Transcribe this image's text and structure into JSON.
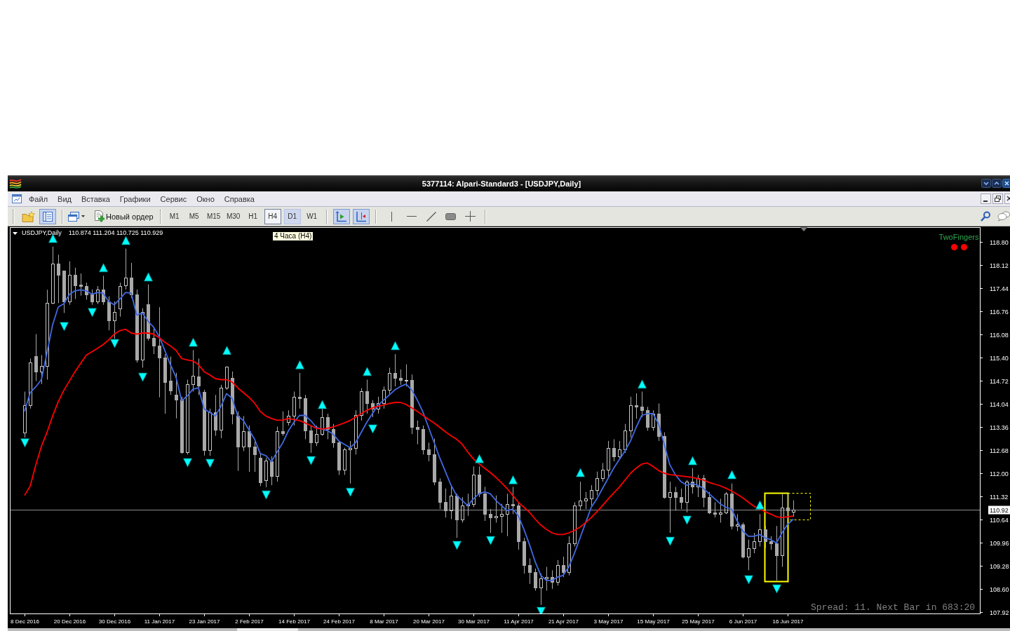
{
  "window": {
    "title": "5377114: Alpari-Standard3 - [USDJPY,Daily]"
  },
  "menu": [
    "Файл",
    "Вид",
    "Вставка",
    "Графики",
    "Сервис",
    "Окно",
    "Справка"
  ],
  "toolbar": {
    "standard": [
      {
        "pressed": false
      },
      {
        "pressed": true
      }
    ],
    "new_order": "Новый ордер",
    "timeframes": [
      {
        "label": "M1",
        "selected": false,
        "hovered": false
      },
      {
        "label": "M5",
        "selected": false,
        "hovered": false
      },
      {
        "label": "M15",
        "selected": false,
        "hovered": false
      },
      {
        "label": "M30",
        "selected": false,
        "hovered": false
      },
      {
        "label": "H1",
        "selected": false,
        "hovered": false
      },
      {
        "label": "H4",
        "selected": false,
        "hovered": true
      },
      {
        "label": "D1",
        "selected": true,
        "hovered": false
      },
      {
        "label": "W1",
        "selected": false,
        "hovered": false
      }
    ],
    "chart_view": [
      {
        "pressed": true
      },
      {
        "pressed": true
      }
    ]
  },
  "tooltip": {
    "text": "4 Часа (H4)"
  },
  "chart": {
    "header": {
      "symbol": "USDJPY,Daily",
      "prices": "110.874 111.204 110.725 110.929"
    },
    "indicator": {
      "label": "TwoFingers",
      "dots": [
        {
          "color": "#ff0000"
        },
        {
          "color": "#ff0000"
        }
      ]
    },
    "status": "Spread: 11. Next Bar in 683:20",
    "drawings": [
      {
        "dashed": false
      },
      {
        "dashed": true
      }
    ],
    "chart_data": [
      {
        "type": "candlestick",
        "categories": [
          "8 Dec 2016",
          null,
          null,
          null,
          null,
          null,
          null,
          null,
          "20 Dec 2016",
          null,
          null,
          null,
          null,
          null,
          null,
          null,
          "30 Dec 2016",
          null,
          null,
          null,
          null,
          null,
          null,
          null,
          "11 Jan 2017",
          null,
          null,
          null,
          null,
          null,
          null,
          null,
          "23 Jan 2017",
          null,
          null,
          null,
          null,
          null,
          null,
          null,
          "2 Feb 2017",
          null,
          null,
          null,
          null,
          null,
          null,
          null,
          "14 Feb 2017",
          null,
          null,
          null,
          null,
          null,
          null,
          null,
          "24 Feb 2017",
          null,
          null,
          null,
          null,
          null,
          null,
          null,
          "8 Mar 2017",
          null,
          null,
          null,
          null,
          null,
          null,
          null,
          "20 Mar 2017",
          null,
          null,
          null,
          null,
          null,
          null,
          null,
          "30 Mar 2017",
          null,
          null,
          null,
          null,
          null,
          null,
          null,
          "11 Apr 2017",
          null,
          null,
          null,
          null,
          null,
          null,
          null,
          "21 Apr 2017",
          null,
          null,
          null,
          null,
          null,
          null,
          null,
          "3 May 2017",
          null,
          null,
          null,
          null,
          null,
          null,
          null,
          "15 May 2017",
          null,
          null,
          null,
          null,
          null,
          null,
          null,
          "25 May 2017",
          null,
          null,
          null,
          null,
          null,
          null,
          null,
          "6 Jun 2017",
          null,
          null,
          null,
          null,
          null,
          null,
          null,
          "16 Jun 2017",
          null
        ],
        "ylim": [
          107.88,
          119.21
        ],
        "yticks": [
          {
            "value": 118.8,
            "label": "118.80"
          },
          {
            "value": 118.12,
            "label": "118.12"
          },
          {
            "value": 117.44,
            "label": "117.44"
          },
          {
            "value": 116.76,
            "label": "116.76"
          },
          {
            "value": 116.08,
            "label": "116.08"
          },
          {
            "value": 115.4,
            "label": "115.40"
          },
          {
            "value": 114.72,
            "label": "114.72"
          },
          {
            "value": 114.04,
            "label": "114.04"
          },
          {
            "value": 113.36,
            "label": "113.36"
          },
          {
            "value": 112.68,
            "label": "112.68"
          },
          {
            "value": 112.0,
            "label": "112.00"
          },
          {
            "value": 111.32,
            "label": "111.32"
          },
          {
            "value": 110.64,
            "label": "110.64"
          },
          {
            "value": 109.96,
            "label": "109.96"
          },
          {
            "value": 109.28,
            "label": "109.28"
          },
          {
            "value": 108.6,
            "label": "108.60"
          },
          {
            "value": 107.92,
            "label": "107.92"
          }
        ],
        "ohlc": [
          [
            113.2,
            114.4,
            113.05,
            114.0
          ],
          [
            114.0,
            115.37,
            113.9,
            115.26
          ],
          [
            115.43,
            116.09,
            114.71,
            114.99
          ],
          [
            114.99,
            115.47,
            114.62,
            115.16
          ],
          [
            115.16,
            117.39,
            114.75,
            117.01
          ],
          [
            117.01,
            118.66,
            116.97,
            118.15
          ],
          [
            118.15,
            118.42,
            117.0,
            117.82
          ],
          [
            117.95,
            117.95,
            116.71,
            117.05
          ],
          [
            117.05,
            118.23,
            116.95,
            117.84
          ],
          [
            117.84,
            118.04,
            117.12,
            117.53
          ],
          [
            117.55,
            117.87,
            117.22,
            117.49
          ],
          [
            117.49,
            117.6,
            117.1,
            117.25
          ],
          [
            117.25,
            117.4,
            116.95,
            117.05
          ],
          [
            117.05,
            117.5,
            116.97,
            117.39
          ],
          [
            117.39,
            117.8,
            116.95,
            117.05
          ],
          [
            117.05,
            117.2,
            116.2,
            116.5
          ],
          [
            116.5,
            117.05,
            115.95,
            116.74
          ],
          [
            116.84,
            117.6,
            116.6,
            117.5
          ],
          [
            117.53,
            118.6,
            117.4,
            117.74
          ],
          [
            117.74,
            118.18,
            117.15,
            117.25
          ],
          [
            117.25,
            117.4,
            115.25,
            115.33
          ],
          [
            115.33,
            116.85,
            115.1,
            116.74
          ],
          [
            116.96,
            117.55,
            115.9,
            115.98
          ],
          [
            115.98,
            116.3,
            115.5,
            115.74
          ],
          [
            115.74,
            116.88,
            114.23,
            115.4
          ],
          [
            115.4,
            115.5,
            113.75,
            114.68
          ],
          [
            114.71,
            115.43,
            114.3,
            114.44
          ],
          [
            114.3,
            114.95,
            113.61,
            114.16
          ],
          [
            114.16,
            114.25,
            112.57,
            112.62
          ],
          [
            112.62,
            114.75,
            112.55,
            114.61
          ],
          [
            114.61,
            115.62,
            114.4,
            114.86
          ],
          [
            114.85,
            115.37,
            114.3,
            114.58
          ],
          [
            114.39,
            114.45,
            112.52,
            112.69
          ],
          [
            112.69,
            113.9,
            112.51,
            113.79
          ],
          [
            113.79,
            114.3,
            113.1,
            113.27
          ],
          [
            113.27,
            114.6,
            113.03,
            114.51
          ],
          [
            114.51,
            115.14,
            114.45,
            115.13
          ],
          [
            114.8,
            114.99,
            113.44,
            113.75
          ],
          [
            113.68,
            113.82,
            112.07,
            112.79
          ],
          [
            112.79,
            113.68,
            112.65,
            113.24
          ],
          [
            113.24,
            113.4,
            112.04,
            112.79
          ],
          [
            112.79,
            112.95,
            112.04,
            112.55
          ],
          [
            112.45,
            112.6,
            111.62,
            111.73
          ],
          [
            111.8,
            112.45,
            111.59,
            112.38
          ],
          [
            112.34,
            112.5,
            111.65,
            111.91
          ],
          [
            111.91,
            113.37,
            111.75,
            113.24
          ],
          [
            113.24,
            113.82,
            113.1,
            113.17
          ],
          [
            113.5,
            113.85,
            113.4,
            113.68
          ],
          [
            113.68,
            114.4,
            113.4,
            114.25
          ],
          [
            114.25,
            114.95,
            113.9,
            114.2
          ],
          [
            114.2,
            114.3,
            113.0,
            113.25
          ],
          [
            113.25,
            113.4,
            112.6,
            112.9
          ],
          [
            112.9,
            113.4,
            112.8,
            113.15
          ],
          [
            113.15,
            113.95,
            113.1,
            113.65
          ],
          [
            113.65,
            113.75,
            113.0,
            113.3
          ],
          [
            113.3,
            113.45,
            112.75,
            112.9
          ],
          [
            112.9,
            112.95,
            111.95,
            112.1
          ],
          [
            112.1,
            112.75,
            111.95,
            112.7
          ],
          [
            112.7,
            112.95,
            111.7,
            112.75
          ],
          [
            112.75,
            113.85,
            112.55,
            113.7
          ],
          [
            113.7,
            114.5,
            113.55,
            114.4
          ],
          [
            114.4,
            114.75,
            113.75,
            114.05
          ],
          [
            114.05,
            114.15,
            113.65,
            113.9
          ],
          [
            113.9,
            114.25,
            113.75,
            114.05
          ],
          [
            114.05,
            114.55,
            113.9,
            114.45
          ],
          [
            114.45,
            115.1,
            114.3,
            114.95
          ],
          [
            114.95,
            115.5,
            114.55,
            114.8
          ],
          [
            114.8,
            115.05,
            114.6,
            114.75
          ],
          [
            114.75,
            115.2,
            114.55,
            114.75
          ],
          [
            114.75,
            114.9,
            113.15,
            113.35
          ],
          [
            113.35,
            113.55,
            112.85,
            113.3
          ],
          [
            113.3,
            113.4,
            112.55,
            112.7
          ],
          [
            112.7,
            112.9,
            112.35,
            112.55
          ],
          [
            112.55,
            113.02,
            111.65,
            111.75
          ],
          [
            111.75,
            111.85,
            110.95,
            111.15
          ],
          [
            111.15,
            111.55,
            110.7,
            110.9
          ],
          [
            110.9,
            111.6,
            110.65,
            111.35
          ],
          [
            111.35,
            111.4,
            110.1,
            110.65
          ],
          [
            110.65,
            111.3,
            110.55,
            111.05
          ],
          [
            111.05,
            111.4,
            110.75,
            111.1
          ],
          [
            111.1,
            112.2,
            111.0,
            111.95
          ],
          [
            111.95,
            112.2,
            111.3,
            111.4
          ],
          [
            111.4,
            111.6,
            110.6,
            110.8
          ],
          [
            110.8,
            110.95,
            110.25,
            110.7
          ],
          [
            110.7,
            111.35,
            110.55,
            110.75
          ],
          [
            110.75,
            111.1,
            110.25,
            110.8
          ],
          [
            110.8,
            111.4,
            110.15,
            111.1
          ],
          [
            111.1,
            111.6,
            110.8,
            111.05
          ],
          [
            111.05,
            111.15,
            109.75,
            110.0
          ],
          [
            110.0,
            110.1,
            109.05,
            109.3
          ],
          [
            109.3,
            109.5,
            108.75,
            109.1
          ],
          [
            109.1,
            109.2,
            108.55,
            108.65
          ],
          [
            108.65,
            109.05,
            108.13,
            108.9
          ],
          [
            108.9,
            109.25,
            108.55,
            108.95
          ],
          [
            108.95,
            109.15,
            108.6,
            108.8
          ],
          [
            108.8,
            109.45,
            108.7,
            109.3
          ],
          [
            109.3,
            109.55,
            108.95,
            109.1
          ],
          [
            109.1,
            110.15,
            109.0,
            109.95
          ],
          [
            109.95,
            111.15,
            109.85,
            111.05
          ],
          [
            111.05,
            111.75,
            110.9,
            111.2
          ],
          [
            111.2,
            111.45,
            110.95,
            111.25
          ],
          [
            111.25,
            111.65,
            111.05,
            111.5
          ],
          [
            111.5,
            112.05,
            111.35,
            111.85
          ],
          [
            111.85,
            112.3,
            111.75,
            112.1
          ],
          [
            112.1,
            112.95,
            111.9,
            112.75
          ],
          [
            112.75,
            113.0,
            112.35,
            112.5
          ],
          [
            112.5,
            112.95,
            112.4,
            112.7
          ],
          [
            112.7,
            113.45,
            112.6,
            113.25
          ],
          [
            113.25,
            114.25,
            113.05,
            114.0
          ],
          [
            114.0,
            114.35,
            113.6,
            113.95
          ],
          [
            113.95,
            114.4,
            113.65,
            113.85
          ],
          [
            113.85,
            113.95,
            113.25,
            113.35
          ],
          [
            113.35,
            113.85,
            113.25,
            113.75
          ],
          [
            113.75,
            114.05,
            112.95,
            113.1
          ],
          [
            113.1,
            113.2,
            111.25,
            111.3
          ],
          [
            111.3,
            111.75,
            110.25,
            111.45
          ],
          [
            111.45,
            111.6,
            110.9,
            111.3
          ],
          [
            111.3,
            111.55,
            110.95,
            111.15
          ],
          [
            111.15,
            111.8,
            110.85,
            111.75
          ],
          [
            111.75,
            112.15,
            111.4,
            111.6
          ],
          [
            111.6,
            111.95,
            111.3,
            111.85
          ],
          [
            111.85,
            111.95,
            111.0,
            111.3
          ],
          [
            111.3,
            111.45,
            110.8,
            110.85
          ],
          [
            110.85,
            111.15,
            110.7,
            110.8
          ],
          [
            110.8,
            111.25,
            110.55,
            110.85
          ],
          [
            110.85,
            111.45,
            110.8,
            111.4
          ],
          [
            111.4,
            111.7,
            110.35,
            110.45
          ],
          [
            110.45,
            110.8,
            110.3,
            110.5
          ],
          [
            110.5,
            110.55,
            109.5,
            109.55
          ],
          [
            109.55,
            110.05,
            109.15,
            109.8
          ],
          [
            109.8,
            110.25,
            109.65,
            110.0
          ],
          [
            110.0,
            110.8,
            109.85,
            110.35
          ],
          [
            110.35,
            110.45,
            109.8,
            110.0
          ],
          [
            110.0,
            110.15,
            109.75,
            109.95
          ],
          [
            109.95,
            110.45,
            108.85,
            109.6
          ],
          [
            109.6,
            111.4,
            109.25,
            111.0
          ],
          [
            111.0,
            111.4,
            110.65,
            110.9
          ],
          [
            110.874,
            111.204,
            110.725,
            110.929
          ]
        ],
        "series": [
          {
            "type": "line",
            "color": "#4169e1",
            "values": [
              113.82,
              114.37,
              114.54,
              114.75,
              115.54,
              116.36,
              116.88,
              116.98,
              117.26,
              117.36,
              117.39,
              117.36,
              117.26,
              117.31,
              117.29,
              117.05,
              116.95,
              117.12,
              117.31,
              117.29,
              116.65,
              116.71,
              116.47,
              116.29,
              116.02,
              115.61,
              115.19,
              114.82,
              114.13,
              114.27,
              114.47,
              114.51,
              113.89,
              113.79,
              113.68,
              113.96,
              114.34,
              114.2,
              113.68,
              113.55,
              113.27,
              113.0,
              112.58,
              112.52,
              112.34,
              112.62,
              112.89,
              113.24,
              113.5,
              113.7,
              113.7,
              113.55,
              113.35,
              113.3,
              113.25,
              113.15,
              112.95,
              112.85,
              112.75,
              112.9,
              113.2,
              113.5,
              113.75,
              114.0,
              114.15,
              114.3,
              114.45,
              114.55,
              114.62,
              114.45,
              114.15,
              113.8,
              113.35,
              112.9,
              112.45,
              112.05,
              111.65,
              111.35,
              111.2,
              111.05,
              111.25,
              111.4,
              111.45,
              111.4,
              111.2,
              111.05,
              110.9,
              110.95,
              110.75,
              110.35,
              109.9,
              109.4,
              109.0,
              108.85,
              108.85,
              108.95,
              109.0,
              109.25,
              109.65,
              110.1,
              110.55,
              111.0,
              111.25,
              111.55,
              111.85,
              112.15,
              112.4,
              112.65,
              112.95,
              113.35,
              113.7,
              113.75,
              113.75,
              113.45,
              112.85,
              112.25,
              111.95,
              111.75,
              111.65,
              111.7,
              111.65,
              111.55,
              111.4,
              111.25,
              111.1,
              111.0,
              110.95,
              110.6,
              110.3,
              110.15,
              110.15,
              110.2,
              110.1,
              110.05,
              109.95,
              110.25,
              110.5,
              110.65
            ]
          },
          {
            "type": "line",
            "color": "#ff0000",
            "values": [
              111.35,
              111.62,
              112.24,
              112.79,
              113.2,
              113.68,
              114.1,
              114.44,
              114.71,
              114.99,
              115.23,
              115.47,
              115.57,
              115.67,
              115.78,
              115.92,
              116.09,
              116.19,
              116.23,
              116.12,
              116.09,
              116.12,
              116.12,
              116.09,
              115.98,
              115.85,
              115.74,
              115.61,
              115.37,
              115.33,
              115.3,
              115.19,
              114.99,
              114.89,
              114.78,
              114.75,
              114.75,
              114.68,
              114.51,
              114.37,
              114.23,
              114.06,
              113.82,
              113.68,
              113.61,
              113.56,
              113.56,
              113.61,
              113.58,
              113.55,
              113.48,
              113.4,
              113.32,
              113.3,
              113.32,
              113.36,
              113.42,
              113.48,
              113.55,
              113.65,
              113.75,
              113.85,
              113.92,
              113.97,
              114.0,
              114.05,
              114.08,
              114.08,
              114.02,
              113.92,
              113.82,
              113.7,
              113.58,
              113.48,
              113.35,
              113.22,
              113.1,
              113.0,
              112.85,
              112.62,
              112.42,
              112.28,
              112.15,
              112.02,
              111.88,
              111.72,
              111.55,
              111.35,
              111.15,
              111.0,
              110.85,
              110.65,
              110.48,
              110.35,
              110.25,
              110.2,
              110.2,
              110.25,
              110.32,
              110.42,
              110.55,
              110.7,
              110.87,
              111.05,
              111.24,
              111.42,
              111.59,
              111.8,
              112.0,
              112.15,
              112.27,
              112.3,
              112.2,
              112.08,
              112.0,
              111.96,
              111.94,
              111.92,
              111.9,
              111.88,
              111.84,
              111.8,
              111.73,
              111.68,
              111.63,
              111.56,
              111.48,
              111.38,
              111.28,
              111.15,
              111.03,
              110.95,
              110.87,
              110.8,
              110.72,
              110.7,
              110.72,
              110.74
            ]
          },
          {
            "type": "scatter",
            "marker": "triangle",
            "color": "#00ffff",
            "values": [
              null,
              null,
              null,
              null,
              null,
              118.9,
              null,
              null,
              null,
              null,
              null,
              null,
              null,
              null,
              118.04,
              null,
              null,
              null,
              118.84,
              null,
              null,
              null,
              117.77,
              null,
              null,
              null,
              null,
              null,
              null,
              null,
              115.85,
              null,
              null,
              null,
              null,
              null,
              115.61,
              null,
              null,
              null,
              null,
              null,
              null,
              null,
              null,
              null,
              null,
              null,
              null,
              115.19,
              null,
              null,
              null,
              114.02,
              null,
              null,
              null,
              null,
              null,
              null,
              null,
              114.99,
              null,
              null,
              null,
              null,
              115.75,
              null,
              null,
              null,
              null,
              null,
              null,
              null,
              null,
              null,
              null,
              null,
              null,
              null,
              null,
              112.43,
              null,
              null,
              null,
              null,
              null,
              111.81,
              null,
              null,
              null,
              null,
              null,
              null,
              null,
              null,
              null,
              null,
              null,
              112.02,
              null,
              null,
              null,
              null,
              null,
              null,
              null,
              null,
              null,
              null,
              114.62,
              null,
              null,
              null,
              null,
              null,
              null,
              null,
              null,
              112.37,
              null,
              null,
              null,
              null,
              null,
              null,
              111.96,
              null,
              null,
              null,
              null,
              111.07,
              null,
              null,
              null,
              null,
              null,
              null
            ]
          },
          {
            "type": "scatter",
            "marker": "triangle",
            "color": "#00ffff",
            "values": [
              112.89,
              null,
              null,
              null,
              null,
              null,
              null,
              116.31,
              null,
              null,
              null,
              null,
              116.72,
              null,
              null,
              null,
              115.81,
              null,
              null,
              null,
              null,
              114.82,
              null,
              null,
              null,
              null,
              null,
              null,
              null,
              112.31,
              null,
              null,
              null,
              112.29,
              null,
              null,
              null,
              null,
              null,
              null,
              null,
              null,
              null,
              111.36,
              null,
              null,
              null,
              null,
              null,
              null,
              null,
              112.37,
              null,
              null,
              null,
              null,
              null,
              null,
              111.44,
              null,
              null,
              null,
              113.3,
              null,
              null,
              null,
              null,
              null,
              null,
              null,
              null,
              null,
              null,
              null,
              null,
              null,
              null,
              109.88,
              null,
              null,
              null,
              null,
              null,
              110.02,
              null,
              null,
              null,
              null,
              null,
              null,
              null,
              null,
              107.94,
              null,
              null,
              null,
              null,
              null,
              null,
              null,
              null,
              null,
              null,
              null,
              null,
              null,
              null,
              null,
              null,
              null,
              null,
              null,
              null,
              null,
              null,
              110.0,
              null,
              null,
              110.62,
              null,
              null,
              null,
              null,
              null,
              null,
              null,
              null,
              null,
              null,
              108.87,
              null,
              null,
              null,
              null,
              108.6,
              null,
              null,
              null
            ]
          }
        ],
        "ref_lines": [
          {
            "axis": "y",
            "value": 110.92,
            "label": "110.92",
            "color": "#8c8c8c"
          }
        ]
      }
    ]
  }
}
